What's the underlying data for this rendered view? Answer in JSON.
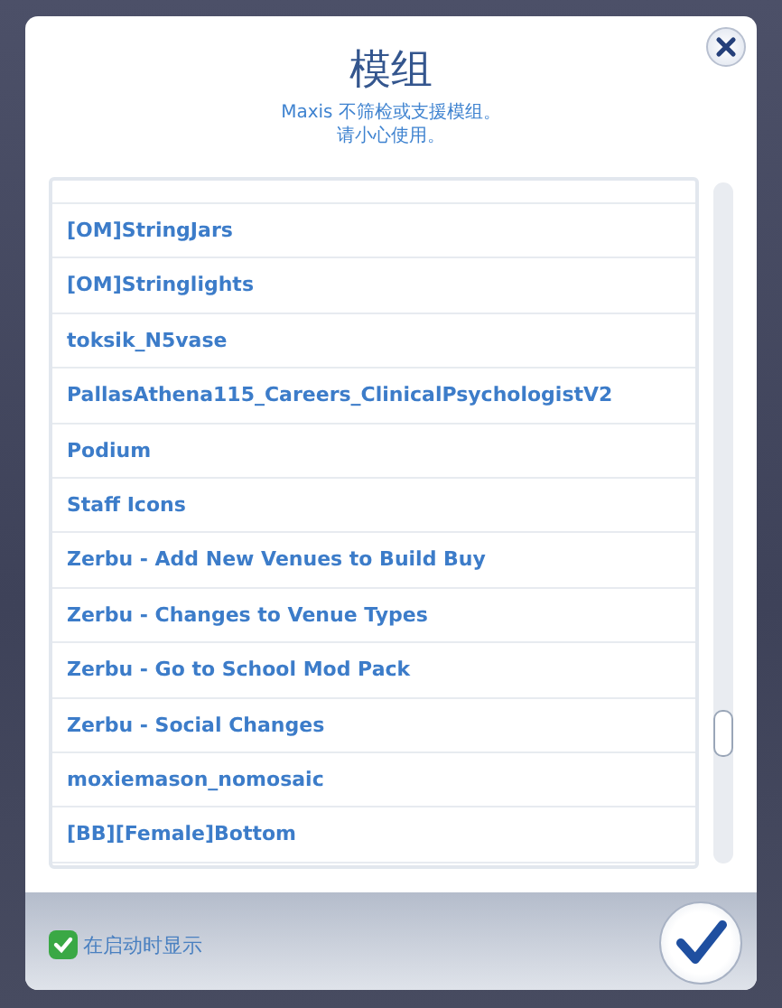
{
  "dialog": {
    "title": "模组",
    "subtitle_lines": [
      "Maxis 不筛检或支援模组。",
      "请小心使用。"
    ],
    "mods": [
      {
        "name": "[OM]StringJars"
      },
      {
        "name": "[OM]Stringlights"
      },
      {
        "name": "toksik_N5vase"
      },
      {
        "name": "PallasAthena115_Careers_ClinicalPsychologistV2"
      },
      {
        "name": "Podium"
      },
      {
        "name": "Staff Icons"
      },
      {
        "name": "Zerbu - Add New Venues to Build Buy"
      },
      {
        "name": "Zerbu - Changes to Venue Types"
      },
      {
        "name": "Zerbu - Go to School Mod Pack"
      },
      {
        "name": "Zerbu - Social Changes"
      },
      {
        "name": "moxiemason_nomosaic"
      },
      {
        "name": "[BB][Female]Bottom"
      }
    ],
    "show_on_startup": {
      "label": "在启动时显示",
      "checked": true
    }
  }
}
